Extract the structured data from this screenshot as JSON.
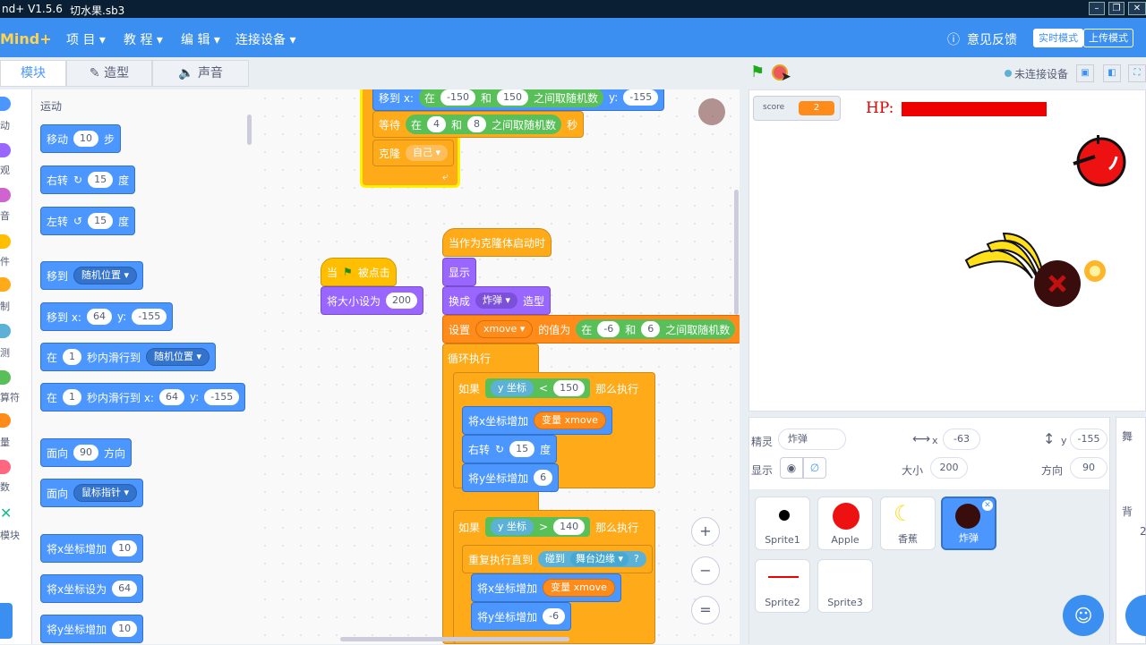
{
  "window": {
    "title_version": "nd+ V1.5.6",
    "file": "切水果.sb3"
  },
  "menubar": {
    "logo": "Mind+",
    "items": [
      "项 目 ▾",
      "教 程 ▾",
      "编 辑 ▾",
      "连接设备 ▾"
    ],
    "feedback": "意见反馈",
    "mode_live": "实时模式",
    "mode_upload": "上传模式"
  },
  "tabs": {
    "blocks": "模块",
    "costumes": "造型",
    "sounds": "声音"
  },
  "categories": [
    {
      "label": "动",
      "color": "#4c97ff"
    },
    {
      "label": "观",
      "color": "#9966ff"
    },
    {
      "label": "音",
      "color": "#cf63cf"
    },
    {
      "label": "件",
      "color": "#ffbf00"
    },
    {
      "label": "制",
      "color": "#ffab19"
    },
    {
      "label": "测",
      "color": "#5cb1d6"
    },
    {
      "label": "算符",
      "color": "#59c059"
    },
    {
      "label": "量",
      "color": "#ff8c1a"
    },
    {
      "label": "数",
      "color": "#ff6680"
    },
    {
      "label": "模块",
      "color": "#0fbd8c"
    }
  ],
  "palette": {
    "heading": "运动",
    "move": {
      "a": "移动",
      "v": "10",
      "b": "步"
    },
    "turn_right": {
      "a": "右转",
      "icon": "↻",
      "v": "15",
      "b": "度"
    },
    "turn_left": {
      "a": "左转",
      "icon": "↺",
      "v": "15",
      "b": "度"
    },
    "goto": {
      "a": "移到",
      "d": "随机位置 ▾"
    },
    "goto_xy": {
      "a": "移到 x:",
      "x": "64",
      "y_label": "y:",
      "y": "-155"
    },
    "glide": {
      "a": "在",
      "v": "1",
      "b": "秒内滑行到",
      "d": "随机位置 ▾"
    },
    "glide_xy": {
      "a": "在",
      "v": "1",
      "b": "秒内滑行到 x:",
      "x": "64",
      "y_label": "y:",
      "y": "-155"
    },
    "point": {
      "a": "面向",
      "v": "90",
      "b": "方向"
    },
    "point_to": {
      "a": "面向",
      "d": "鼠标指针 ▾"
    },
    "change_x": {
      "a": "将x坐标增加",
      "v": "10"
    },
    "set_x": {
      "a": "将x坐标设为",
      "v": "64"
    },
    "change_y": {
      "a": "将y坐标增加",
      "v": "10"
    }
  },
  "script1": {
    "goto_rand": {
      "a": "移到 x:",
      "b": "在",
      "v1": "-150",
      "c": "和",
      "v2": "150",
      "d": "之间取随机数",
      "e": "y:",
      "v3": "-155"
    },
    "wait": {
      "a": "等待",
      "b": "在",
      "v1": "4",
      "c": "和",
      "v2": "8",
      "d": "之间取随机数",
      "e": "秒"
    },
    "clone": {
      "a": "克隆",
      "d": "自己 ▾"
    }
  },
  "script2": {
    "hat": {
      "a": "当",
      "b": "被点击"
    },
    "size": {
      "a": "将大小设为",
      "v": "200"
    }
  },
  "script3": {
    "hat": "当作为克隆体启动时",
    "show": "显示",
    "costume": {
      "a": "换成",
      "d": "炸弹 ▾",
      "b": "造型"
    },
    "setvar": {
      "a": "设置",
      "d": "xmove ▾",
      "b": "的值为",
      "c": "在",
      "v1": "-6",
      "e": "和",
      "v2": "6",
      "f": "之间取随机数"
    },
    "forever": "循环执行",
    "if1": {
      "a": "如果",
      "r": "y 坐标",
      "op": "<",
      "v": "150",
      "b": "那么执行"
    },
    "chx": {
      "a": "将x坐标增加",
      "b": "变量",
      "v": "xmove"
    },
    "turn": {
      "a": "右转",
      "icon": "↻",
      "v": "15",
      "b": "度"
    },
    "chy": {
      "a": "将y坐标增加",
      "v": "6"
    },
    "if2": {
      "a": "如果",
      "r": "y 坐标",
      "op": ">",
      "v": "140",
      "b": "那么执行"
    },
    "until": {
      "a": "重复执行直到",
      "b": "碰到",
      "d": "舞台边缘 ▾",
      "q": "?"
    },
    "chx2": {
      "a": "将x坐标增加",
      "b": "变量",
      "v": "xmove"
    },
    "chy2": {
      "a": "将y坐标增加",
      "v": "-6"
    }
  },
  "stage_header": {
    "device": "未连接设备"
  },
  "stage": {
    "score_label": "score",
    "score_value": "2",
    "hp_label": "HP:"
  },
  "sprite_info": {
    "sprite_label": "精灵",
    "sprite_name": "炸弹",
    "x_label": "x",
    "x": "-63",
    "y_label": "y",
    "y": "-155",
    "show_label": "显示",
    "size_label": "大小",
    "size": "200",
    "direction_label": "方向",
    "direction": "90"
  },
  "sprites": [
    {
      "name": "Sprite1",
      "icon": "dot"
    },
    {
      "name": "Apple",
      "icon": "apple"
    },
    {
      "name": "香蕉",
      "icon": "banana"
    },
    {
      "name": "炸弹",
      "icon": "bomb",
      "selected": true
    },
    {
      "name": "Sprite2",
      "icon": "line"
    },
    {
      "name": "Sprite3",
      "icon": "blank"
    }
  ],
  "right_pane": {
    "title": "舞",
    "label": "背",
    "value": "2"
  }
}
